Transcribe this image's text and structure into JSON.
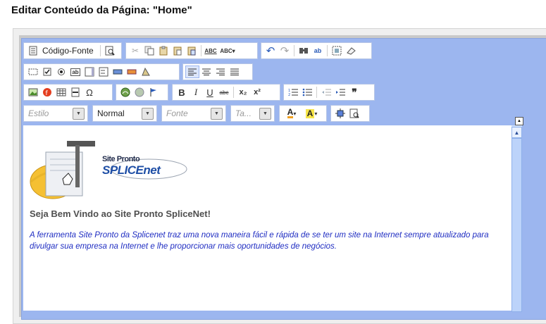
{
  "page": {
    "title": "Editar Conteúdo da Página: \"Home\""
  },
  "toolbar": {
    "source_label": "Código-Fonte",
    "combos": {
      "style_placeholder": "Estilo",
      "format_value": "Normal",
      "font_placeholder": "Fonte",
      "size_placeholder": "Ta..."
    },
    "glyphs": {
      "bold": "B",
      "italic": "I",
      "underline": "U",
      "strike": "abc",
      "subscript": "x₂",
      "superscript": "x²",
      "quote": "❞",
      "omega": "Ω",
      "text_color": "A",
      "bg_color": "A",
      "spell": "ABC",
      "undo": "↶",
      "redo": "↷"
    }
  },
  "content": {
    "logo_top": "Site Pronto",
    "logo_bottom": "SPLICEnet",
    "heading": "Seja Bem Vindo ao Site Pronto SpliceNet!",
    "paragraph": "A ferramenta Site Pronto da Splicenet traz uma nova maneira fácil e rápida de se ter um site na Internet sempre atualizado para divulgar sua empresa na Internet e lhe proporcionar mais oportunidades de negócios."
  },
  "colors": {
    "editor_bg": "#9cb6ef",
    "paragraph_text": "#1f2dc2",
    "heading_text": "#4f4f4f"
  }
}
